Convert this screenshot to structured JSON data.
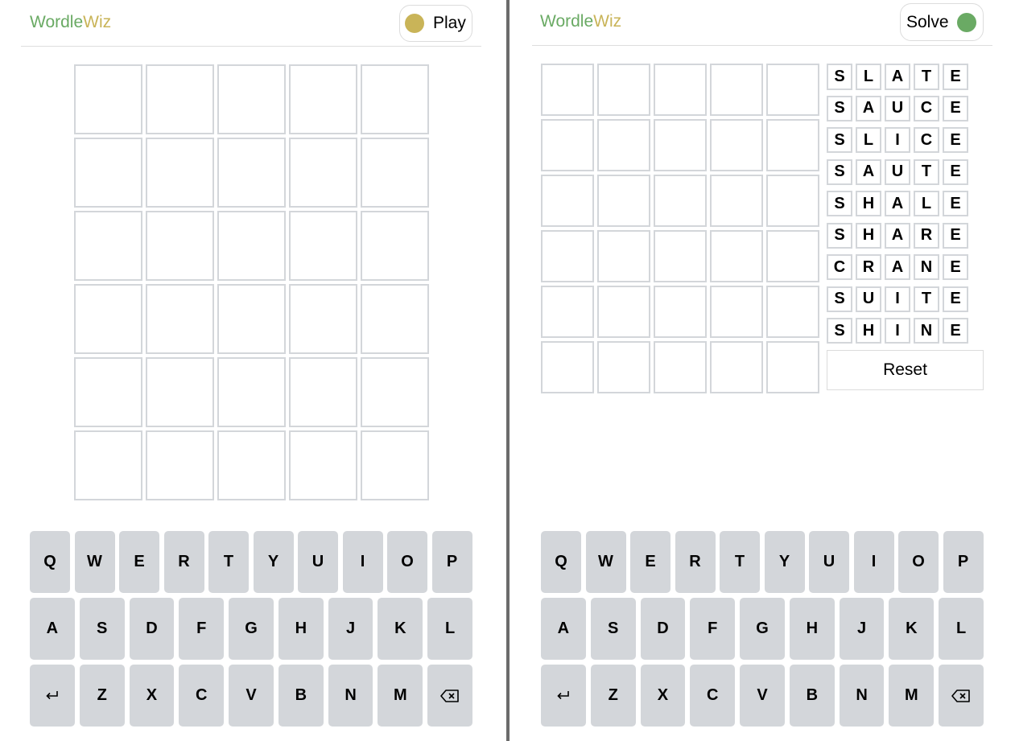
{
  "play": {
    "logo_part1": "Wordle",
    "logo_part2": "Wiz",
    "mode_label": "Play",
    "grid_rows": 6,
    "grid_cols": 5
  },
  "solve": {
    "logo_part1": "Wordle",
    "logo_part2": "Wiz",
    "mode_label": "Solve",
    "grid_rows": 6,
    "grid_cols": 5,
    "suggestions": [
      "SLATE",
      "SAUCE",
      "SLICE",
      "SAUTE",
      "SHALE",
      "SHARE",
      "CRANE",
      "SUITE",
      "SHINE"
    ],
    "reset_label": "Reset"
  },
  "keyboard": {
    "rows": [
      [
        "Q",
        "W",
        "E",
        "R",
        "T",
        "Y",
        "U",
        "I",
        "O",
        "P"
      ],
      [
        "A",
        "S",
        "D",
        "F",
        "G",
        "H",
        "J",
        "K",
        "L"
      ],
      [
        "enter-icon",
        "Z",
        "X",
        "C",
        "V",
        "B",
        "N",
        "M",
        "backspace-icon"
      ]
    ],
    "enter_glyph": "↵"
  },
  "colors": {
    "green": "#6aaa64",
    "yellow": "#c9b458",
    "key_bg": "#d3d6da",
    "tile_border": "#d3d6da"
  }
}
